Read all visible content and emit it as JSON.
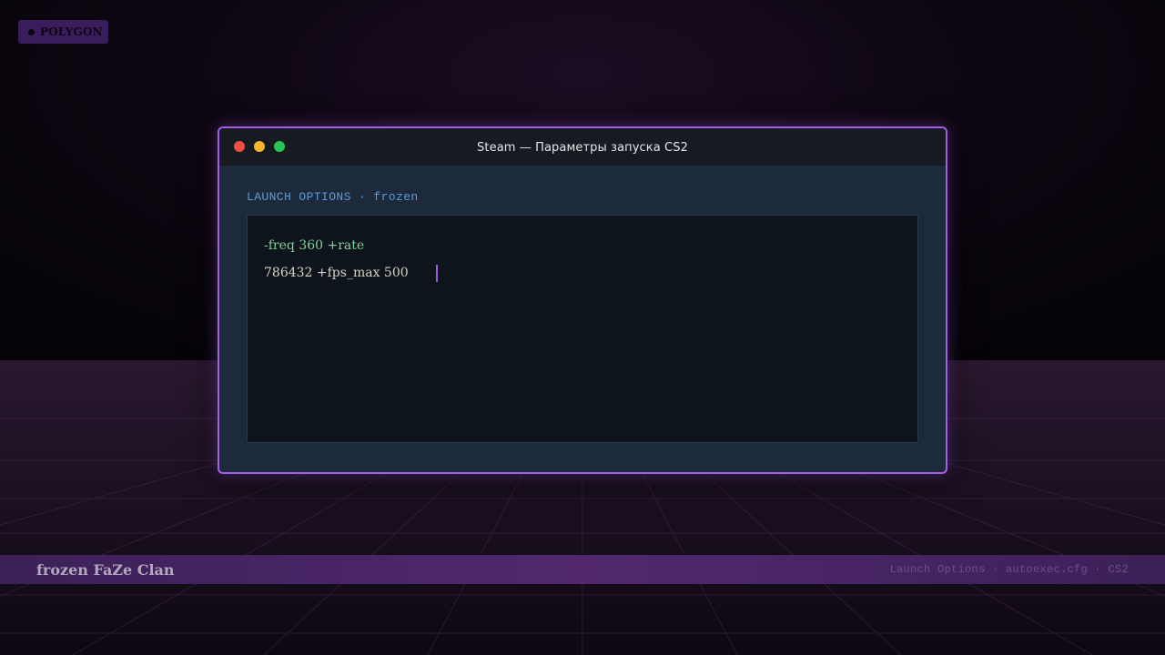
{
  "badge": {
    "label": "POLYGON"
  },
  "window": {
    "title": "Steam — Параметры запуска CS2",
    "section_label": "LAUNCH OPTIONS · frozen",
    "editor": {
      "line1": "-freq 360 +rate",
      "line2": "786432 +fps_max 500"
    }
  },
  "footer": {
    "left_text": "frozen FaZe Clan",
    "right_text": "Launch Options · autoexec.cfg · CS2"
  },
  "colors": {
    "accent": "#a35ee6",
    "window_bg": "#1d2a3b",
    "editor_bg": "#0e141b",
    "code_green": "#7fd39b",
    "footer_bar": "#51286e"
  },
  "icons": [
    "close-icon",
    "minimize-icon",
    "maximize-icon",
    "dot-icon",
    "text-cursor-icon"
  ]
}
